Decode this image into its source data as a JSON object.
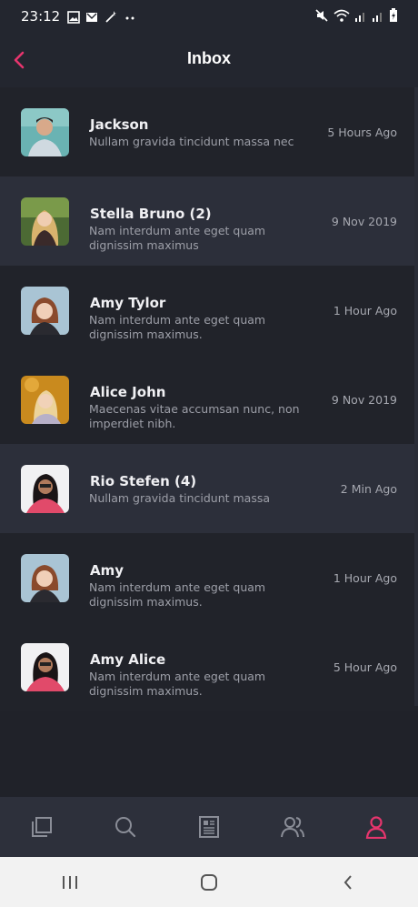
{
  "status_bar": {
    "time": "23:12"
  },
  "header": {
    "title": "Inbox"
  },
  "colors": {
    "accent": "#e6356d",
    "background": "#23262f",
    "highlight_row": "#2c2f3a"
  },
  "messages": [
    {
      "name": "Jackson",
      "preview": "Nullam gravida tincidunt massa nec",
      "time": "5 Hours Ago"
    },
    {
      "name": "Stella Bruno (2)",
      "preview": " Nam interdum ante eget quam\ndignissim maximus",
      "time": "9 Nov 2019"
    },
    {
      "name": "Amy Tylor",
      "preview": " Nam interdum ante eget quam\ndignissim maximus.",
      "time": "1 Hour Ago"
    },
    {
      "name": "Alice John",
      "preview": "Maecenas vitae accumsan nunc, non\nimperdiet nibh.",
      "time": "9 Nov 2019"
    },
    {
      "name": "Rio Stefen (4)",
      "preview": "Nullam gravida tincidunt massa",
      "time": "2 Min Ago"
    },
    {
      "name": "Amy",
      "preview": " Nam interdum ante eget quam\ndignissim maximus.",
      "time": "1 Hour Ago"
    },
    {
      "name": "Amy Alice",
      "preview": " Nam interdum ante eget quam\ndignissim maximus.",
      "time": "5 Hour Ago"
    }
  ],
  "bottom_nav": {
    "items": [
      {
        "icon": "layers-icon"
      },
      {
        "icon": "search-icon"
      },
      {
        "icon": "newspaper-icon"
      },
      {
        "icon": "users-icon"
      },
      {
        "icon": "profile-icon",
        "active": true
      }
    ]
  }
}
